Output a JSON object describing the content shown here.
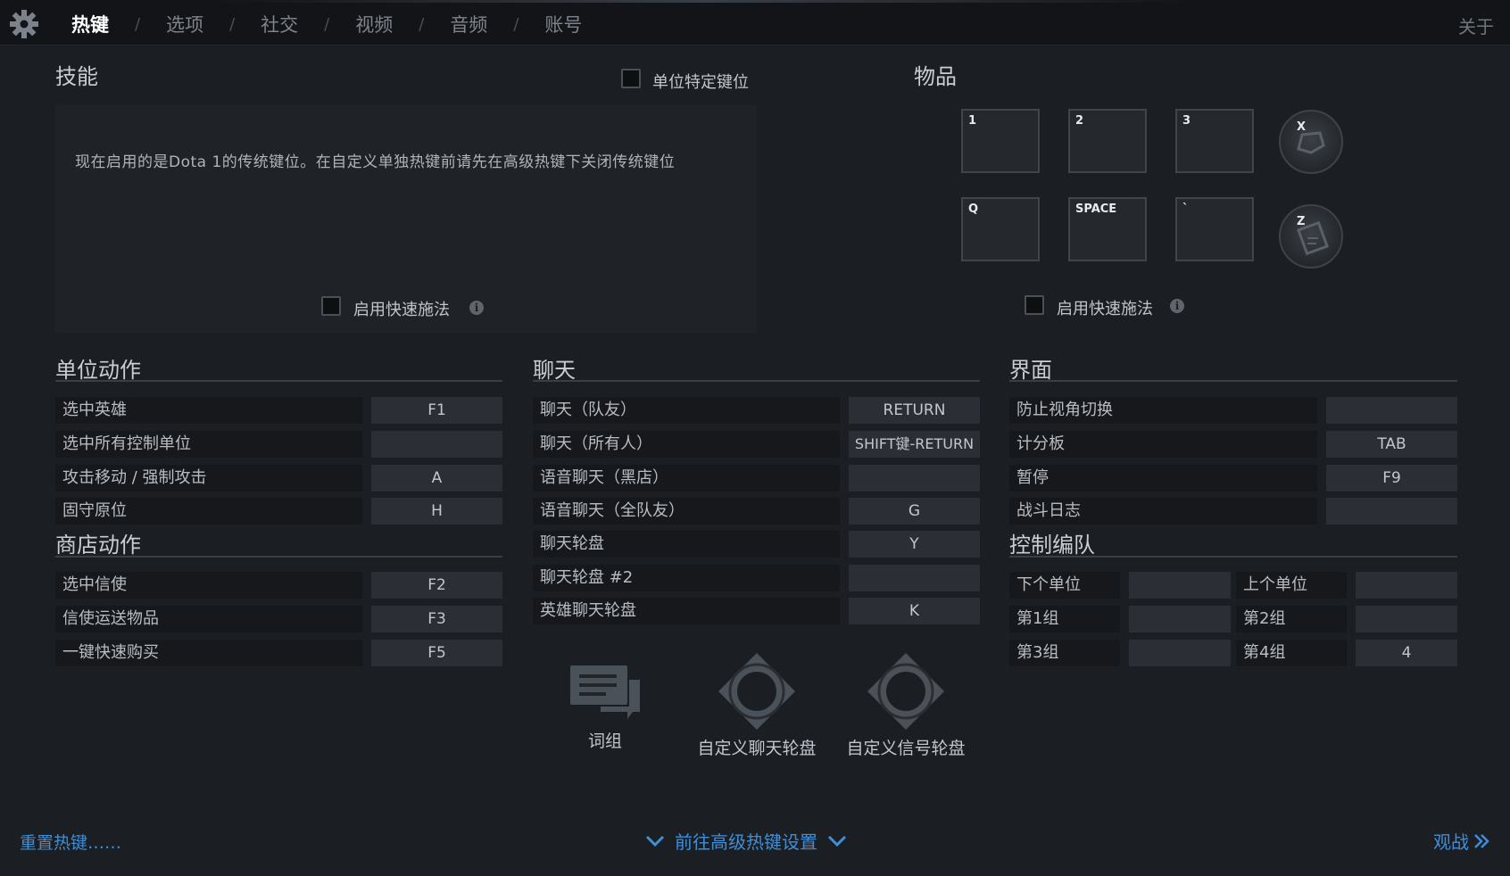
{
  "tabs": [
    {
      "label": "热键",
      "active": true
    },
    {
      "label": "选项"
    },
    {
      "label": "社交"
    },
    {
      "label": "视频"
    },
    {
      "label": "音频"
    },
    {
      "label": "账号"
    }
  ],
  "tab_separator": "/",
  "about": "关于",
  "skills": {
    "title": "技能",
    "unit_specific_label": "单位特定键位",
    "notice": "现在启用的是Dota 1的传统键位。在自定义单独热键前请先在高级热键下关闭传统键位",
    "quickcast_label": "启用快速施法",
    "info": "i"
  },
  "items": {
    "title": "物品",
    "slots_row1": [
      "1",
      "2",
      "3"
    ],
    "slots_row2": [
      "Q",
      "SPACE",
      "`"
    ],
    "round_keys": [
      "X",
      "Z"
    ],
    "quickcast_label": "启用快速施法",
    "info": "i"
  },
  "unit_actions": {
    "title": "单位动作",
    "rows": [
      {
        "label": "选中英雄",
        "key": "F1"
      },
      {
        "label": "选中所有控制单位",
        "key": ""
      },
      {
        "label": "攻击移动 / 强制攻击",
        "key": "A"
      },
      {
        "label": "固守原位",
        "key": "H"
      }
    ]
  },
  "shop_actions": {
    "title": "商店动作",
    "rows": [
      {
        "label": "选中信使",
        "key": "F2"
      },
      {
        "label": "信使运送物品",
        "key": "F3"
      },
      {
        "label": "一键快速购买",
        "key": "F5"
      }
    ]
  },
  "chat": {
    "title": "聊天",
    "rows": [
      {
        "label": "聊天（队友）",
        "key": "RETURN"
      },
      {
        "label": "聊天（所有人）",
        "key": "SHIFT键-RETURN"
      },
      {
        "label": "语音聊天（黑店）",
        "key": ""
      },
      {
        "label": "语音聊天（全队友）",
        "key": "G"
      },
      {
        "label": "聊天轮盘",
        "key": "Y"
      },
      {
        "label": "聊天轮盘 #2",
        "key": ""
      },
      {
        "label": "英雄聊天轮盘",
        "key": "K"
      }
    ],
    "buttons": [
      {
        "label": "词组",
        "icon": "speech-bubble-icon"
      },
      {
        "label": "自定义聊天轮盘",
        "icon": "wheel-icon"
      },
      {
        "label": "自定义信号轮盘",
        "icon": "wheel-icon"
      }
    ]
  },
  "interface": {
    "title": "界面",
    "rows": [
      {
        "label": "防止视角切换",
        "key": ""
      },
      {
        "label": "计分板",
        "key": "TAB"
      },
      {
        "label": "暂停",
        "key": "F9"
      },
      {
        "label": "战斗日志",
        "key": ""
      }
    ]
  },
  "control_groups": {
    "title": "控制编队",
    "rows": [
      [
        {
          "label": "下个单位",
          "key": ""
        },
        {
          "label": "上个单位",
          "key": ""
        }
      ],
      [
        {
          "label": "第1组",
          "key": ""
        },
        {
          "label": "第2组",
          "key": ""
        }
      ],
      [
        {
          "label": "第3组",
          "key": ""
        },
        {
          "label": "第4组",
          "key": "4"
        }
      ]
    ]
  },
  "footer": {
    "reset": "重置热键……",
    "advanced": "前往高级热键设置",
    "spectate": "观战"
  },
  "colors": {
    "background": "#1b1e23",
    "link": "#3e8fd8",
    "active_tab": "#ffffff"
  }
}
